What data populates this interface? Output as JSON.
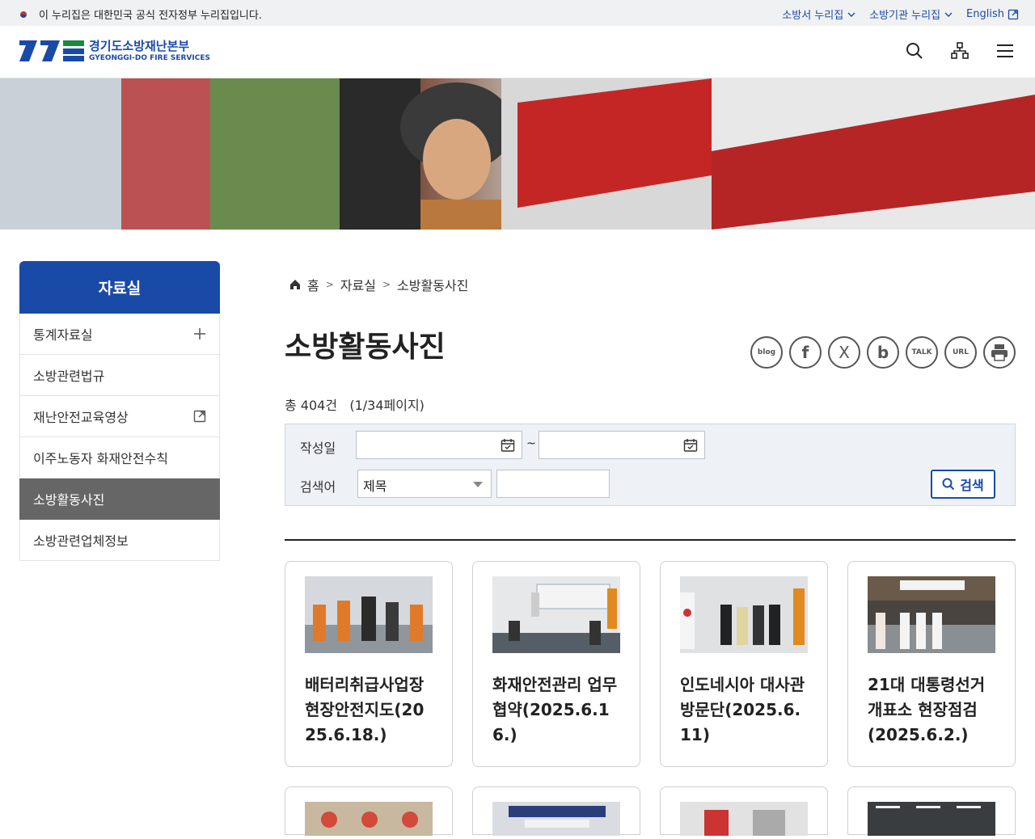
{
  "topbar": {
    "gov_notice": "이 누리집은 대한민국 공식 전자정부 누리집입니다.",
    "links": [
      "소방서 누리집",
      "소방기관 누리집",
      "English"
    ]
  },
  "logo": {
    "name": "경기도소방재난본부",
    "name_en": "GYEONGGI-DO FIRE SERVICES"
  },
  "colors": {
    "brand": "#1a4aa8",
    "brand_green": "#1a8a3c",
    "active_menu": "#666666"
  },
  "sidebar": {
    "title": "자료실",
    "items": [
      {
        "label": "통계자료실",
        "icon": "plus-icon"
      },
      {
        "label": "소방관련법규"
      },
      {
        "label": "재난안전교육영상",
        "icon": "external-link-icon"
      },
      {
        "label": "이주노동자 화재안전수칙"
      },
      {
        "label": "소방활동사진",
        "active": true
      },
      {
        "label": "소방관련업체정보"
      }
    ]
  },
  "breadcrumb": [
    "홈",
    "자료실",
    "소방활동사진"
  ],
  "page_title": "소방활동사진",
  "share": [
    "blog",
    "f",
    "X",
    "b",
    "TALK",
    "URL",
    "print"
  ],
  "count_text": "총 404건",
  "page_text": "(1/34페이지)",
  "search": {
    "date_label": "작성일",
    "date_sep": "~",
    "keyword_label": "검색어",
    "select_value": "제목",
    "button": "검색"
  },
  "cards": [
    {
      "title": "배터리취급사업장 현장안전지도(2025.6.18.)"
    },
    {
      "title": "화재안전관리 업무협약(2025.6.16.)"
    },
    {
      "title": "인도네시아 대사관 방문단(2025.6.11)"
    },
    {
      "title": "21대 대통령선거 개표소 현장점검(2025.6.2.)"
    }
  ]
}
